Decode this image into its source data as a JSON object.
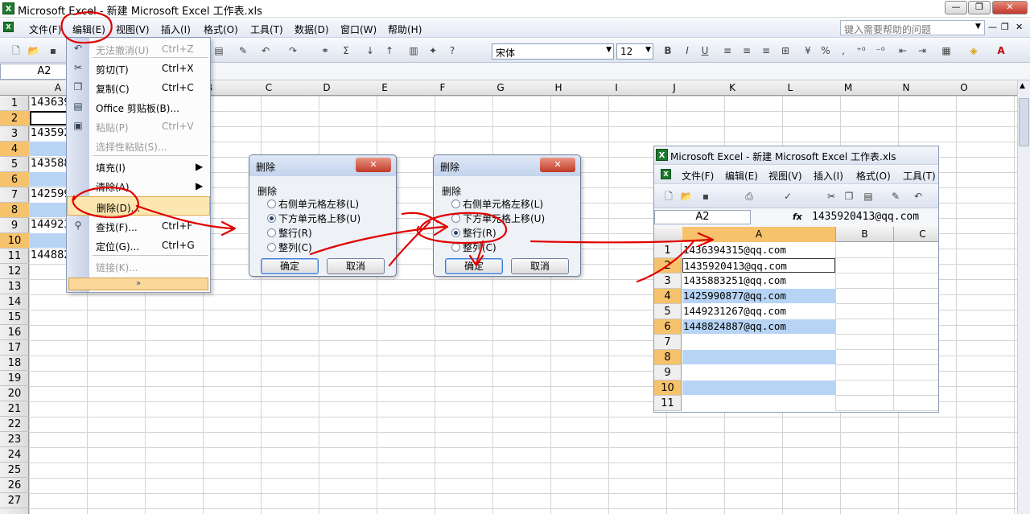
{
  "window": {
    "title": "Microsoft Excel - 新建 Microsoft Excel 工作表.xls",
    "min": "—",
    "max": "❐",
    "close": "✕"
  },
  "menubar": {
    "items": [
      "文件(F)",
      "编辑(E)",
      "视图(V)",
      "插入(I)",
      "格式(O)",
      "工具(T)",
      "数据(D)",
      "窗口(W)",
      "帮助(H)"
    ],
    "help_placeholder": "键入需要帮助的问题"
  },
  "toolbar": {
    "font": "宋体",
    "size": "12",
    "bold": "B",
    "italic": "I",
    "underline": "U",
    "percent": "%",
    "comma": ","
  },
  "namebox": "A2",
  "columns": [
    "A",
    "B",
    "C",
    "D",
    "E",
    "F",
    "G",
    "H",
    "I",
    "J",
    "K",
    "L",
    "M",
    "N",
    "O"
  ],
  "rows": [
    "1",
    "2",
    "3",
    "4",
    "5",
    "6",
    "7",
    "8",
    "9",
    "10",
    "11",
    "12",
    "13",
    "14",
    "15",
    "16",
    "17",
    "18",
    "19",
    "20",
    "21",
    "22",
    "23",
    "24",
    "25",
    "26",
    "27"
  ],
  "main_cells": [
    {
      "row": 1,
      "text": "143639",
      "blue": false,
      "selected": false
    },
    {
      "row": 2,
      "text": "",
      "blue": false,
      "selected": true
    },
    {
      "row": 3,
      "text": "143592",
      "blue": false,
      "selected": false
    },
    {
      "row": 4,
      "text": "",
      "blue": true,
      "selected": false
    },
    {
      "row": 5,
      "text": "143588",
      "blue": false,
      "selected": false
    },
    {
      "row": 6,
      "text": "",
      "blue": true,
      "selected": false
    },
    {
      "row": 7,
      "text": "142599",
      "blue": false,
      "selected": false
    },
    {
      "row": 8,
      "text": "",
      "blue": true,
      "selected": false
    },
    {
      "row": 9,
      "text": "144923",
      "blue": false,
      "selected": false
    },
    {
      "row": 10,
      "text": "",
      "blue": true,
      "selected": false
    },
    {
      "row": 11,
      "text": "144882",
      "blue": false,
      "selected": false
    }
  ],
  "edit_menu": {
    "items": [
      {
        "label": "无法撤消(U)",
        "shortcut": "Ctrl+Z",
        "disabled": true,
        "icon": "↶"
      },
      {
        "label": "剪切(T)",
        "shortcut": "Ctrl+X",
        "disabled": false,
        "icon": "✂"
      },
      {
        "label": "复制(C)",
        "shortcut": "Ctrl+C",
        "disabled": false,
        "icon": "❐"
      },
      {
        "label": "Office 剪贴板(B)...",
        "shortcut": "",
        "disabled": false,
        "icon": "▤"
      },
      {
        "label": "粘贴(P)",
        "shortcut": "Ctrl+V",
        "disabled": true,
        "icon": "▣"
      },
      {
        "label": "选择性粘贴(S)...",
        "shortcut": "",
        "disabled": true,
        "icon": ""
      },
      {
        "label": "填充(I)",
        "shortcut": "▶",
        "disabled": false,
        "icon": ""
      },
      {
        "label": "清除(A)",
        "shortcut": "▶",
        "disabled": false,
        "icon": ""
      },
      {
        "label": "删除(D)...",
        "shortcut": "",
        "disabled": false,
        "icon": ""
      },
      {
        "label": "查找(F)...",
        "shortcut": "Ctrl+F",
        "disabled": false,
        "icon": "⚲"
      },
      {
        "label": "定位(G)...",
        "shortcut": "Ctrl+G",
        "disabled": false,
        "icon": ""
      },
      {
        "label": "链接(K)...",
        "shortcut": "",
        "disabled": true,
        "icon": ""
      }
    ],
    "expand": "»"
  },
  "dialog1": {
    "title": "删除",
    "group": "删除",
    "options": [
      "右侧单元格左移(L)",
      "下方单元格上移(U)",
      "整行(R)",
      "整列(C)"
    ],
    "selected": 1,
    "ok": "确定",
    "cancel": "取消",
    "close": "✕"
  },
  "dialog2": {
    "title": "删除",
    "group": "删除",
    "options": [
      "右侧单元格左移(L)",
      "下方单元格上移(U)",
      "整行(R)",
      "整列(C)"
    ],
    "selected": 2,
    "ok": "确定",
    "cancel": "取消",
    "close": "✕"
  },
  "result_window": {
    "title": "Microsoft Excel - 新建 Microsoft Excel 工作表.xls",
    "menu": [
      "文件(F)",
      "编辑(E)",
      "视图(V)",
      "插入(I)",
      "格式(O)",
      "工具(T)"
    ],
    "namebox": "A2",
    "formula_value": "1435920413@qq.com",
    "columns": [
      "A",
      "B",
      "C"
    ],
    "rows": [
      {
        "n": "1",
        "text": "1436394315@qq.com",
        "blue": false,
        "box": false,
        "hl": false
      },
      {
        "n": "2",
        "text": "1435920413@qq.com",
        "blue": false,
        "box": true,
        "hl": true
      },
      {
        "n": "3",
        "text": "1435883251@qq.com",
        "blue": false,
        "box": false,
        "hl": false
      },
      {
        "n": "4",
        "text": "1425990877@qq.com",
        "blue": true,
        "box": false,
        "hl": true
      },
      {
        "n": "5",
        "text": "1449231267@qq.com",
        "blue": false,
        "box": false,
        "hl": false
      },
      {
        "n": "6",
        "text": "1448824887@qq.com",
        "blue": true,
        "box": false,
        "hl": true
      },
      {
        "n": "7",
        "text": "",
        "blue": false,
        "box": false,
        "hl": false
      },
      {
        "n": "8",
        "text": "",
        "blue": true,
        "box": false,
        "hl": true
      },
      {
        "n": "9",
        "text": "",
        "blue": false,
        "box": false,
        "hl": false
      },
      {
        "n": "10",
        "text": "",
        "blue": true,
        "box": false,
        "hl": true
      },
      {
        "n": "11",
        "text": "",
        "blue": false,
        "box": false,
        "hl": false
      }
    ]
  },
  "annotation_color": "#e00000"
}
